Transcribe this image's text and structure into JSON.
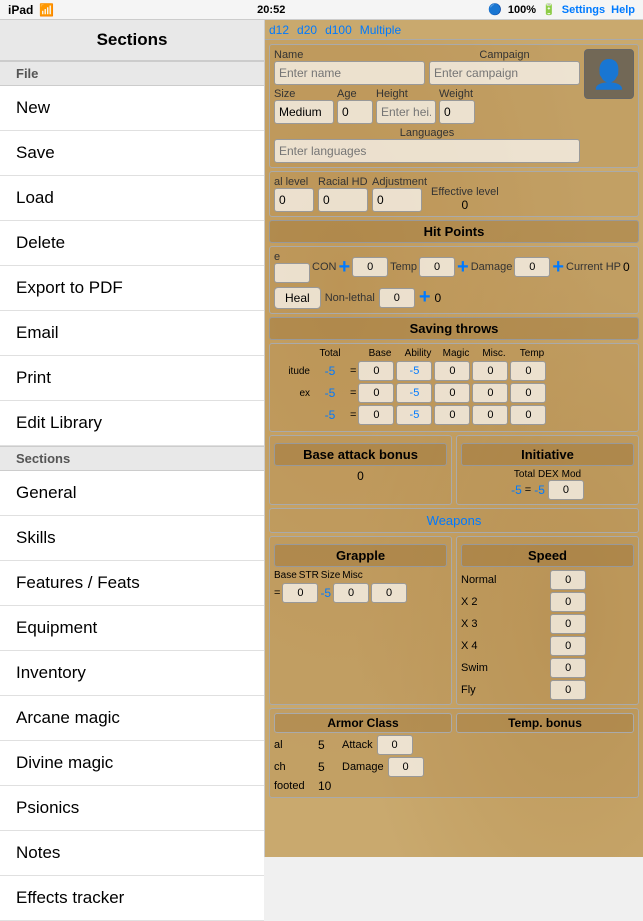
{
  "statusBar": {
    "carrier": "iPad",
    "time": "20:52",
    "dice": [
      "d12",
      "d20",
      "d100",
      "Multiple"
    ],
    "battery": "100%",
    "settings": "Settings",
    "help": "Help"
  },
  "sidebar": {
    "title": "Sections",
    "fileSection": "File",
    "fileItems": [
      "New",
      "Save",
      "Load",
      "Delete",
      "Export to PDF",
      "Email",
      "Print",
      "Edit Library"
    ],
    "sectionsSection": "Sections",
    "sectionItems": [
      "General",
      "Skills",
      "Features / Feats",
      "Equipment",
      "Inventory",
      "Arcane magic",
      "Divine magic",
      "Psionics",
      "Notes",
      "Effects tracker"
    ]
  },
  "sheet": {
    "namePlaceholder": "Enter name",
    "campaignLabel": "Campaign",
    "campaignPlaceholder": "Enter campaign",
    "sizeLabel": "Size",
    "sizeValue": "Medium",
    "ageLabel": "Age",
    "ageValue": "0",
    "heightLabel": "Height",
    "heightPlaceholder": "Enter hei...",
    "weightLabel": "Weight",
    "weightValue": "0",
    "languagesLabel": "Languages",
    "languagesPlaceholder": "Enter languages",
    "racialLevelLabel": "al level",
    "racialLevelValue": "0",
    "racialHDLabel": "Racial HD",
    "racialHDValue": "0",
    "adjustmentLabel": "Adjustment",
    "adjustmentValue": "0",
    "effectiveLevelLabel": "Effective level",
    "effectiveLevelValue": "0",
    "hitPointsTitle": "Hit Points",
    "conLabel": "CON",
    "tempLabel": "Temp",
    "damageLabel": "Damage",
    "currentHPLabel": "Current HP",
    "conValue": "0",
    "tempValue": "0",
    "damageValue": "0",
    "currentHPValue": "0",
    "healButton": "Heal",
    "nonLethalLabel": "Non-lethal",
    "nonLethalValue": "0",
    "nonLethalTotal": "0",
    "savingThrowsTitle": "Saving throws",
    "savingHeaders": [
      "Total",
      "Base",
      "Ability",
      "Magic",
      "Misc.",
      "Temp"
    ],
    "savingRows": [
      {
        "name": "itude",
        "total": "-5",
        "base": "0",
        "ability": "-5",
        "magic": "0",
        "misc": "0",
        "temp": "0"
      },
      {
        "name": "ex",
        "total": "-5",
        "base": "0",
        "ability": "-5",
        "magic": "0",
        "misc": "0",
        "temp": "0"
      },
      {
        "name": "",
        "total": "-5",
        "base": "0",
        "ability": "-5",
        "magic": "0",
        "misc": "0",
        "temp": "0"
      }
    ],
    "baseAttackBonusTitle": "Base attack bonus",
    "baseAttackBonusValue": "0",
    "initiativeTitle": "Initiative",
    "initiativeHeaders": [
      "Total",
      "DEX",
      "Mod"
    ],
    "initiativeValues": [
      "-5",
      "=",
      "-5",
      "0"
    ],
    "weaponsLabel": "Weapons",
    "grappleTitle": "Grapple",
    "grappleHeaders": [
      "Base",
      "STR",
      "Size",
      "Misc"
    ],
    "grappleValues": [
      "=",
      "0",
      "-5",
      "0",
      "0"
    ],
    "speedTitle": "Speed",
    "speedRows": [
      {
        "label": "Normal",
        "value": "0"
      },
      {
        "label": "X 2",
        "value": "0"
      },
      {
        "label": "X 3",
        "value": "0"
      },
      {
        "label": "X 4",
        "value": "0"
      },
      {
        "label": "Swim",
        "value": "0"
      },
      {
        "label": "Fly",
        "value": "0"
      }
    ],
    "armorClassTitle": "Armor Class",
    "tempBonusTitle": "Temp. bonus",
    "acRows": [
      {
        "label": "al",
        "value1": "5",
        "label2": "Attack",
        "value2": "0"
      },
      {
        "label": "ch",
        "value1": "5",
        "label2": "Damage",
        "value2": "0"
      },
      {
        "label": "footed",
        "value1": "10",
        "label2": "",
        "value2": ""
      }
    ]
  }
}
